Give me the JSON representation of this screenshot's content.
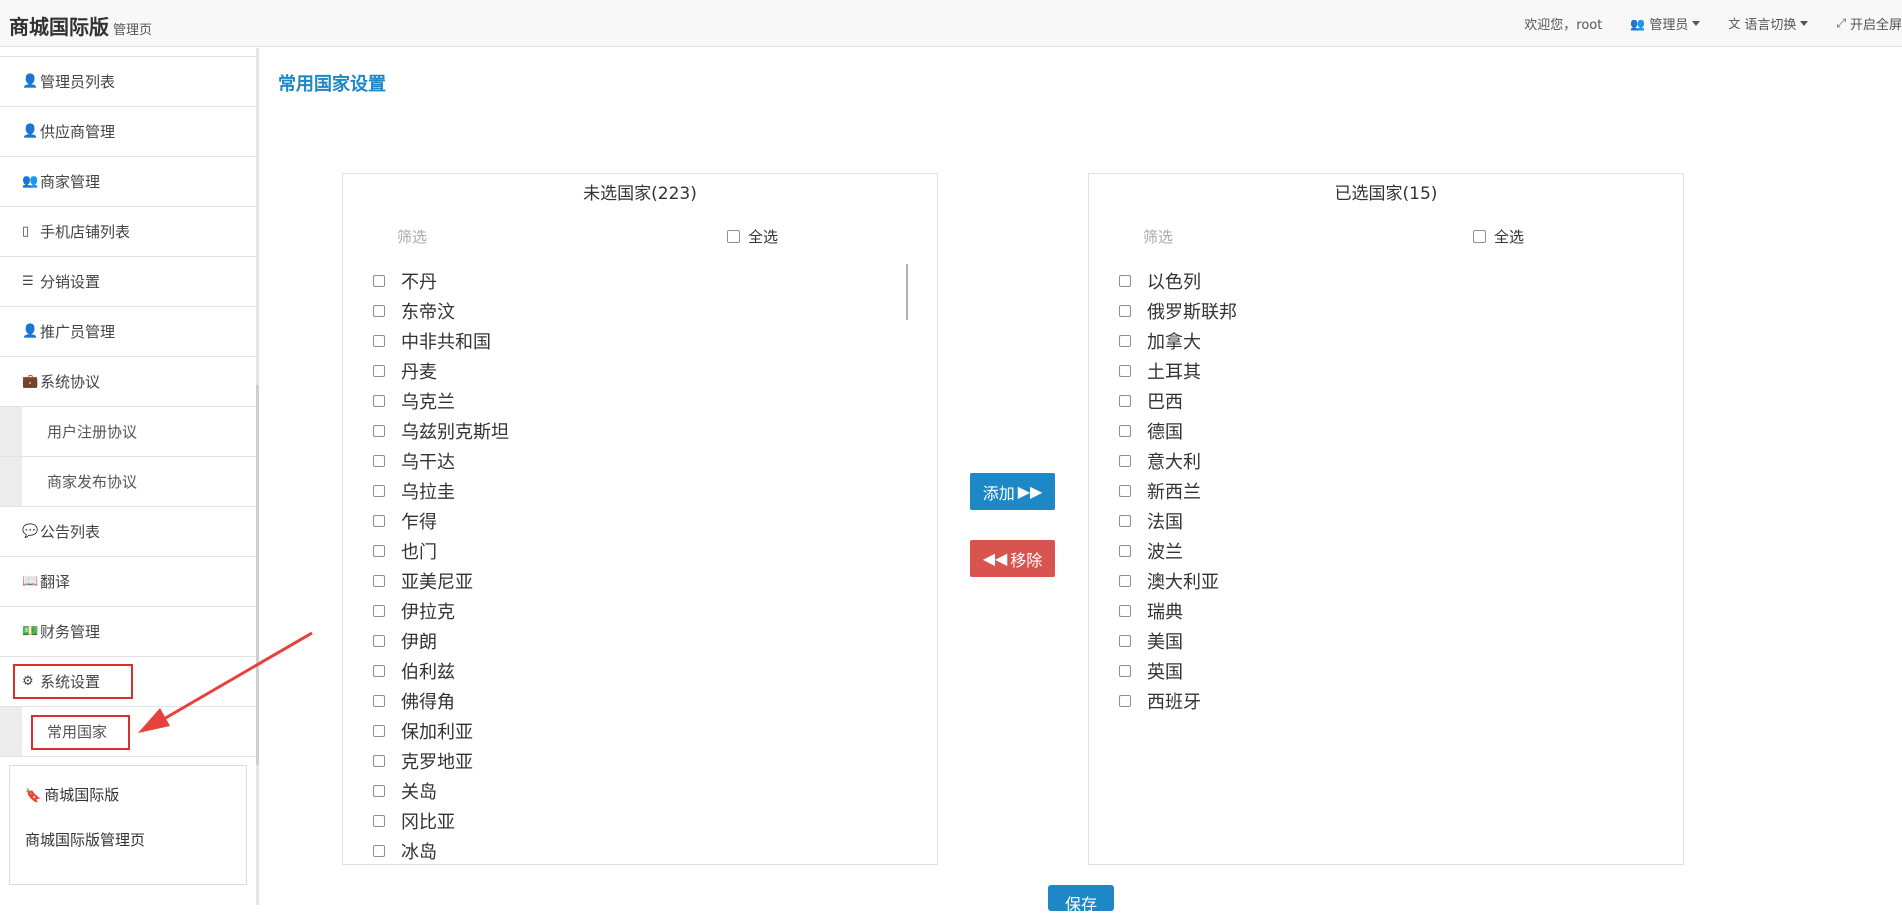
{
  "header": {
    "brand": "商城国际版",
    "brand_sub": "管理页",
    "welcome": "欢迎您，root",
    "admin_label": "管理员",
    "language_label": "语言切换",
    "fullscreen_label": "开启全屏"
  },
  "sidebar": {
    "items": [
      {
        "label": "管理员列表",
        "icon": "user-lock-icon"
      },
      {
        "label": "供应商管理",
        "icon": "user-icon"
      },
      {
        "label": "商家管理",
        "icon": "users-icon"
      },
      {
        "label": "手机店铺列表",
        "icon": "mobile-icon"
      },
      {
        "label": "分销设置",
        "icon": "bars-icon"
      },
      {
        "label": "推广员管理",
        "icon": "user-icon"
      },
      {
        "label": "系统协议",
        "icon": "briefcase-icon"
      }
    ],
    "sub_protocol": [
      "用户注册协议",
      "商家发布协议"
    ],
    "items2": [
      {
        "label": "公告列表",
        "icon": "comment-icon"
      },
      {
        "label": "翻译",
        "icon": "book-icon"
      },
      {
        "label": "财务管理",
        "icon": "money-icon"
      },
      {
        "label": "系统设置",
        "icon": "gear-icon"
      }
    ],
    "sub_settings": [
      "常用国家"
    ],
    "card_title": "商城国际版",
    "card_sub": "商城国际版管理页"
  },
  "main": {
    "title": "常用国家设置",
    "unselected": {
      "title": "未选国家(223)",
      "filter_placeholder": "筛选",
      "select_all": "全选",
      "items": [
        "不丹",
        "东帝汶",
        "中非共和国",
        "丹麦",
        "乌克兰",
        "乌兹别克斯坦",
        "乌干达",
        "乌拉圭",
        "乍得",
        "也门",
        "亚美尼亚",
        "伊拉克",
        "伊朗",
        "伯利兹",
        "佛得角",
        "保加利亚",
        "克罗地亚",
        "关岛",
        "冈比亚",
        "冰岛"
      ]
    },
    "selected": {
      "title": "已选国家(15)",
      "filter_placeholder": "筛选",
      "select_all": "全选",
      "items": [
        "以色列",
        "俄罗斯联邦",
        "加拿大",
        "土耳其",
        "巴西",
        "德国",
        "意大利",
        "新西兰",
        "法国",
        "波兰",
        "澳大利亚",
        "瑞典",
        "美国",
        "英国",
        "西班牙"
      ]
    },
    "add_button": "添加",
    "remove_button": "移除",
    "save_button": "保存"
  },
  "colors": {
    "primary": "#1e88c7",
    "danger": "#d9534f",
    "annotation": "#d9302c"
  }
}
